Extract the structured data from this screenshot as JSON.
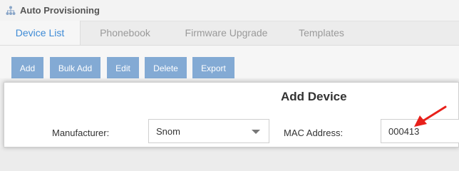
{
  "header": {
    "title": "Auto Provisioning",
    "icon": "sitemap-icon"
  },
  "tabs": [
    {
      "label": "Device List",
      "active": true
    },
    {
      "label": "Phonebook",
      "active": false
    },
    {
      "label": "Firmware Upgrade",
      "active": false
    },
    {
      "label": "Templates",
      "active": false
    }
  ],
  "toolbar": {
    "add_label": "Add",
    "bulk_add_label": "Bulk Add",
    "edit_label": "Edit",
    "delete_label": "Delete",
    "export_label": "Export"
  },
  "dialog": {
    "title": "Add Device",
    "manufacturer_label": "Manufacturer:",
    "manufacturer_value": "Snom",
    "mac_label": "MAC Address:",
    "mac_value": "000413"
  },
  "colors": {
    "accent": "#3f8bd6",
    "button_bg": "#83aad4",
    "annotation_arrow": "#e8201a"
  }
}
